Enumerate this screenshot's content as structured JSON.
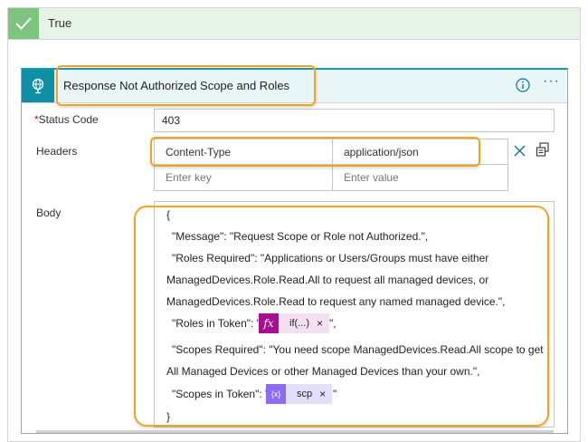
{
  "branch": {
    "title": "True"
  },
  "action": {
    "title": "Response Not Authorized Scope and Roles",
    "more_label": "···"
  },
  "status_code": {
    "required_mark": "*",
    "label": "Status Code",
    "value": "403"
  },
  "headers": {
    "label": "Headers",
    "rows": [
      {
        "key": "Content-Type",
        "value": "application/json"
      }
    ],
    "key_placeholder": "Enter key",
    "value_placeholder": "Enter value"
  },
  "body": {
    "label": "Body",
    "lines": {
      "open": "{",
      "message": "\"Message\": \"Request Scope or Role not Authorized.\",",
      "roles_required_1": "\"Roles Required\": \"Applications or Users/Groups must have either",
      "roles_required_2": "ManagedDevices.Role.Read.All to request all managed devices, or",
      "roles_required_3": "ManagedDevices.Role.Read to request any named managed device.\",",
      "roles_in_token_prefix": "\"Roles in Token\": \"",
      "roles_in_token_suffix": "\",",
      "scopes_required_1": "\"Scopes Required\": \"You need scope ManagedDevices.Read.All scope to get",
      "scopes_required_2": "All Managed Devices or other Managed Devices than your own.\",",
      "scopes_in_token_prefix": "\"Scopes in Token\": \"",
      "scopes_in_token_suffix": "\"",
      "close": "}"
    },
    "tokens": {
      "roles": {
        "icon_text": "fx",
        "label": "if(...)",
        "remove": "×"
      },
      "scopes": {
        "icon_text": "{x}",
        "label": "scp",
        "remove": "×"
      }
    }
  },
  "colors": {
    "branch_header_bg": "#e6f3e6",
    "check_green": "#7cc47f",
    "card_accent": "#0f9bb3",
    "highlight_orange": "#f0a520",
    "expression_token": "#a4108d",
    "variable_token": "#8c6cf0"
  },
  "icons": {
    "branch": "checkmark-icon",
    "action": "globe-response-icon",
    "info": "info-icon",
    "remove_header": "close-icon",
    "switch_mode": "switch-text-mode-icon"
  }
}
